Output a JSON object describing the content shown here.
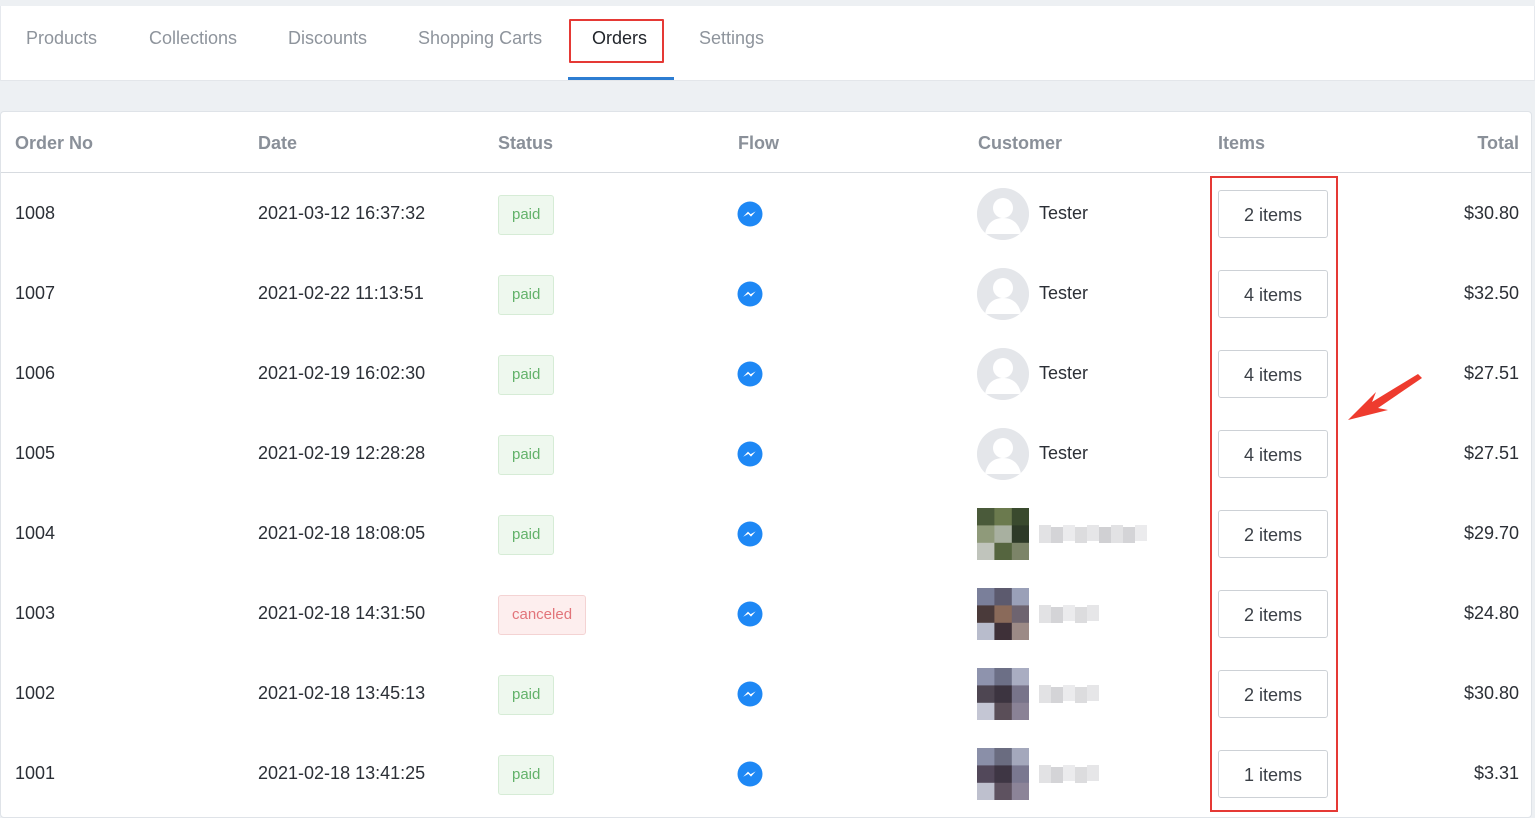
{
  "tabs": [
    {
      "label": "Products"
    },
    {
      "label": "Collections"
    },
    {
      "label": "Discounts"
    },
    {
      "label": "Shopping Carts"
    },
    {
      "label": "Orders"
    },
    {
      "label": "Settings"
    }
  ],
  "active_tab": "Orders",
  "table": {
    "headers": {
      "order_no": "Order No",
      "date": "Date",
      "status": "Status",
      "flow": "Flow",
      "customer": "Customer",
      "items": "Items",
      "total": "Total"
    },
    "rows": [
      {
        "order_no": "1008",
        "date": "2021-03-12 16:37:32",
        "status": "paid",
        "flow_icon": "messenger-icon",
        "customer": "Tester",
        "items": "2 items",
        "total": "$30.80"
      },
      {
        "order_no": "1007",
        "date": "2021-02-22 11:13:51",
        "status": "paid",
        "flow_icon": "messenger-icon",
        "customer": "Tester",
        "items": "4 items",
        "total": "$32.50"
      },
      {
        "order_no": "1006",
        "date": "2021-02-19 16:02:30",
        "status": "paid",
        "flow_icon": "messenger-icon",
        "customer": "Tester",
        "items": "4 items",
        "total": "$27.51"
      },
      {
        "order_no": "1005",
        "date": "2021-02-19 12:28:28",
        "status": "paid",
        "flow_icon": "messenger-icon",
        "customer": "Tester",
        "items": "4 items",
        "total": "$27.51"
      },
      {
        "order_no": "1004",
        "date": "2021-02-18 18:08:05",
        "status": "paid",
        "flow_icon": "messenger-icon",
        "customer": "",
        "items": "2 items",
        "total": "$29.70"
      },
      {
        "order_no": "1003",
        "date": "2021-02-18 14:31:50",
        "status": "canceled",
        "flow_icon": "messenger-icon",
        "customer": "",
        "items": "2 items",
        "total": "$24.80"
      },
      {
        "order_no": "1002",
        "date": "2021-02-18 13:45:13",
        "status": "paid",
        "flow_icon": "messenger-icon",
        "customer": "",
        "items": "2 items",
        "total": "$30.80"
      },
      {
        "order_no": "1001",
        "date": "2021-02-18 13:41:25",
        "status": "paid",
        "flow_icon": "messenger-icon",
        "customer": "",
        "items": "1 items",
        "total": "$3.31"
      }
    ]
  },
  "colors": {
    "accent": "#2d7dd2",
    "highlight": "#e53935",
    "paid": "#62b26a",
    "canceled": "#e2747a",
    "messenger": "#1e88f5"
  }
}
